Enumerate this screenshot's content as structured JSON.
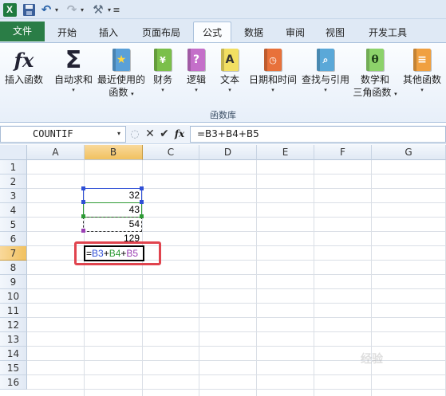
{
  "qat": {
    "app_icon": "excel-icon",
    "app_letter": "X",
    "save_icon": "save-icon",
    "undo_glyph": "↶",
    "redo_glyph": "↷",
    "dropdown_glyph": "▾",
    "tools_glyph": "⚒",
    "customize_glyph": "≡"
  },
  "tabs": {
    "file": "文件",
    "items": [
      "开始",
      "插入",
      "页面布局",
      "公式",
      "数据",
      "审阅",
      "视图",
      "开发工具"
    ],
    "active_index": 3
  },
  "ribbon": {
    "group_label": "函数库",
    "buttons": [
      {
        "label1": "插入函数",
        "label2": "",
        "icon": "fx-icon",
        "glyph": "fx"
      },
      {
        "label1": "自动求和",
        "label2": "",
        "icon": "sigma-icon",
        "glyph": "Σ"
      },
      {
        "label1": "最近使用的",
        "label2": "函数",
        "icon": "recent-star-book-icon",
        "glyph": "★"
      },
      {
        "label1": "财务",
        "label2": "",
        "icon": "finance-book-icon",
        "glyph": "¥"
      },
      {
        "label1": "逻辑",
        "label2": "",
        "icon": "logic-question-book-icon",
        "glyph": "?"
      },
      {
        "label1": "文本",
        "label2": "",
        "icon": "text-book-icon",
        "glyph": "A"
      },
      {
        "label1": "日期和时间",
        "label2": "",
        "icon": "datetime-clock-book-icon",
        "glyph": "◷"
      },
      {
        "label1": "查找与引用",
        "label2": "",
        "icon": "lookup-magnifier-book-icon",
        "glyph": "⌕"
      },
      {
        "label1": "数学和",
        "label2": "三角函数",
        "icon": "math-theta-book-icon",
        "glyph": "θ"
      },
      {
        "label1": "其他函数",
        "label2": "",
        "icon": "more-functions-books-icon",
        "glyph": "≡"
      }
    ],
    "dropdown_glyph": "▾"
  },
  "formula_bar": {
    "name_box": "COUNTIF",
    "name_dropdown": "▾",
    "cancel_glyph": "✕",
    "enter_glyph": "✔",
    "fx_glyph": "fx",
    "formula": "=B3+B4+B5"
  },
  "sheet": {
    "columns": [
      "A",
      "B",
      "C",
      "D",
      "E",
      "F",
      "G"
    ],
    "selected_column": "B",
    "rows": [
      "1",
      "2",
      "3",
      "4",
      "5",
      "6",
      "7",
      "8",
      "9",
      "10",
      "11",
      "12",
      "13",
      "14",
      "15",
      "16"
    ],
    "selected_row": "7",
    "cells": {
      "B3": "32",
      "B4": "43",
      "B5": "54",
      "B6": "129"
    },
    "editing": {
      "prefix": "=",
      "ref1": "B3",
      "op1": "+",
      "ref2": "B4",
      "op2": "+",
      "ref3": "B5"
    }
  },
  "colors": {
    "ref_blue": "#2f4fd6",
    "ref_green": "#2e9a35",
    "ref_purple": "#9b3fb4",
    "highlight_red": "#e0444e",
    "file_tab_green": "#2a7d46"
  },
  "watermark": "经验"
}
